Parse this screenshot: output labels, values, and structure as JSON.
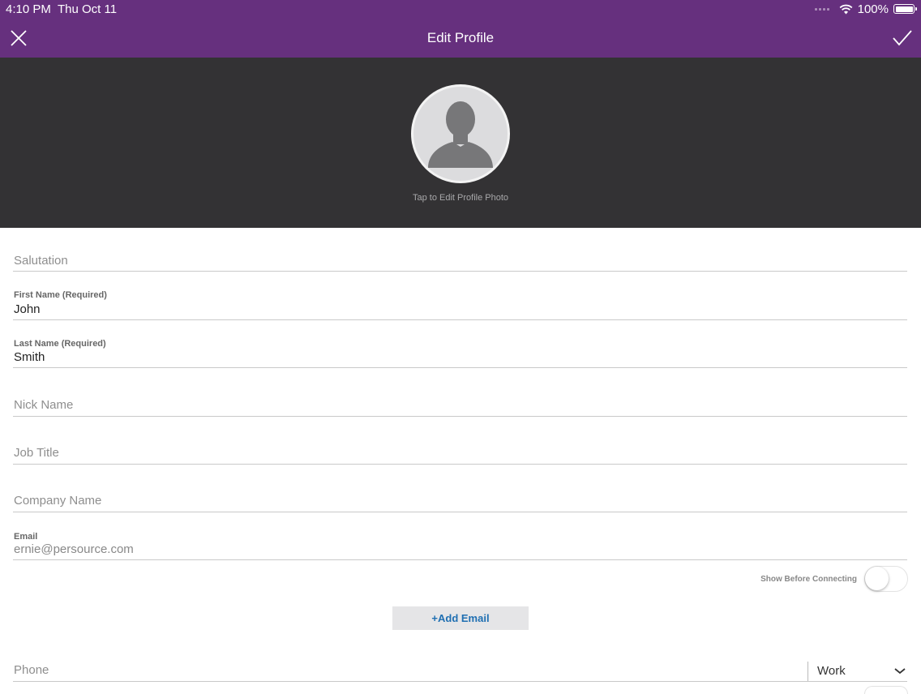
{
  "status_bar": {
    "time": "4:10 PM",
    "date": "Thu Oct 11",
    "battery": "100%"
  },
  "nav": {
    "title": "Edit Profile",
    "close_icon": "close-icon",
    "done_icon": "checkmark-icon",
    "bar_color": "#66307e"
  },
  "photo": {
    "caption": "Tap to Edit Profile Photo",
    "icon": "person-silhouette-icon"
  },
  "form": {
    "salutation": {
      "placeholder": "Salutation"
    },
    "first_name": {
      "label": "First Name (Required)",
      "value": "John"
    },
    "last_name": {
      "label": "Last Name (Required)",
      "value": "Smith"
    },
    "nick_name": {
      "placeholder": "Nick Name"
    },
    "job_title": {
      "placeholder": "Job Title"
    },
    "company_name": {
      "placeholder": "Company Name"
    },
    "email": {
      "label": "Email",
      "value": "ernie@persource.com"
    },
    "show_before_connecting": {
      "label": "Show Before Connecting",
      "on": false
    },
    "add_email": {
      "label": "+Add Email"
    },
    "phone": {
      "placeholder": "Phone",
      "type": "Work"
    }
  }
}
